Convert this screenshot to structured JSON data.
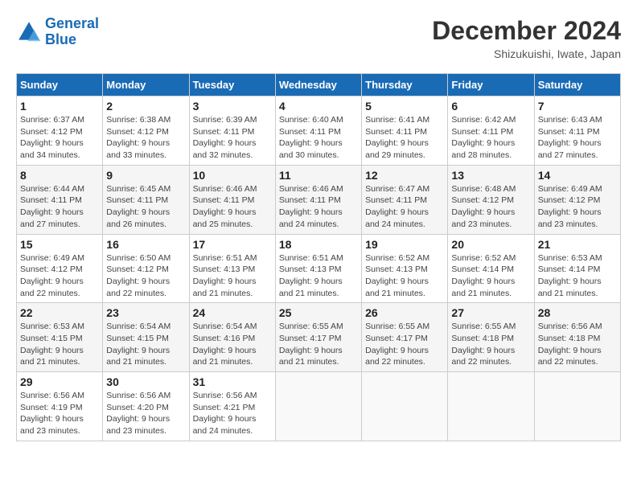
{
  "header": {
    "logo_line1": "General",
    "logo_line2": "Blue",
    "month_title": "December 2024",
    "location": "Shizukuishi, Iwate, Japan"
  },
  "weekdays": [
    "Sunday",
    "Monday",
    "Tuesday",
    "Wednesday",
    "Thursday",
    "Friday",
    "Saturday"
  ],
  "weeks": [
    [
      {
        "day": "1",
        "sunrise": "Sunrise: 6:37 AM",
        "sunset": "Sunset: 4:12 PM",
        "daylight": "Daylight: 9 hours and 34 minutes."
      },
      {
        "day": "2",
        "sunrise": "Sunrise: 6:38 AM",
        "sunset": "Sunset: 4:12 PM",
        "daylight": "Daylight: 9 hours and 33 minutes."
      },
      {
        "day": "3",
        "sunrise": "Sunrise: 6:39 AM",
        "sunset": "Sunset: 4:11 PM",
        "daylight": "Daylight: 9 hours and 32 minutes."
      },
      {
        "day": "4",
        "sunrise": "Sunrise: 6:40 AM",
        "sunset": "Sunset: 4:11 PM",
        "daylight": "Daylight: 9 hours and 30 minutes."
      },
      {
        "day": "5",
        "sunrise": "Sunrise: 6:41 AM",
        "sunset": "Sunset: 4:11 PM",
        "daylight": "Daylight: 9 hours and 29 minutes."
      },
      {
        "day": "6",
        "sunrise": "Sunrise: 6:42 AM",
        "sunset": "Sunset: 4:11 PM",
        "daylight": "Daylight: 9 hours and 28 minutes."
      },
      {
        "day": "7",
        "sunrise": "Sunrise: 6:43 AM",
        "sunset": "Sunset: 4:11 PM",
        "daylight": "Daylight: 9 hours and 27 minutes."
      }
    ],
    [
      {
        "day": "8",
        "sunrise": "Sunrise: 6:44 AM",
        "sunset": "Sunset: 4:11 PM",
        "daylight": "Daylight: 9 hours and 27 minutes."
      },
      {
        "day": "9",
        "sunrise": "Sunrise: 6:45 AM",
        "sunset": "Sunset: 4:11 PM",
        "daylight": "Daylight: 9 hours and 26 minutes."
      },
      {
        "day": "10",
        "sunrise": "Sunrise: 6:46 AM",
        "sunset": "Sunset: 4:11 PM",
        "daylight": "Daylight: 9 hours and 25 minutes."
      },
      {
        "day": "11",
        "sunrise": "Sunrise: 6:46 AM",
        "sunset": "Sunset: 4:11 PM",
        "daylight": "Daylight: 9 hours and 24 minutes."
      },
      {
        "day": "12",
        "sunrise": "Sunrise: 6:47 AM",
        "sunset": "Sunset: 4:11 PM",
        "daylight": "Daylight: 9 hours and 24 minutes."
      },
      {
        "day": "13",
        "sunrise": "Sunrise: 6:48 AM",
        "sunset": "Sunset: 4:12 PM",
        "daylight": "Daylight: 9 hours and 23 minutes."
      },
      {
        "day": "14",
        "sunrise": "Sunrise: 6:49 AM",
        "sunset": "Sunset: 4:12 PM",
        "daylight": "Daylight: 9 hours and 23 minutes."
      }
    ],
    [
      {
        "day": "15",
        "sunrise": "Sunrise: 6:49 AM",
        "sunset": "Sunset: 4:12 PM",
        "daylight": "Daylight: 9 hours and 22 minutes."
      },
      {
        "day": "16",
        "sunrise": "Sunrise: 6:50 AM",
        "sunset": "Sunset: 4:12 PM",
        "daylight": "Daylight: 9 hours and 22 minutes."
      },
      {
        "day": "17",
        "sunrise": "Sunrise: 6:51 AM",
        "sunset": "Sunset: 4:13 PM",
        "daylight": "Daylight: 9 hours and 21 minutes."
      },
      {
        "day": "18",
        "sunrise": "Sunrise: 6:51 AM",
        "sunset": "Sunset: 4:13 PM",
        "daylight": "Daylight: 9 hours and 21 minutes."
      },
      {
        "day": "19",
        "sunrise": "Sunrise: 6:52 AM",
        "sunset": "Sunset: 4:13 PM",
        "daylight": "Daylight: 9 hours and 21 minutes."
      },
      {
        "day": "20",
        "sunrise": "Sunrise: 6:52 AM",
        "sunset": "Sunset: 4:14 PM",
        "daylight": "Daylight: 9 hours and 21 minutes."
      },
      {
        "day": "21",
        "sunrise": "Sunrise: 6:53 AM",
        "sunset": "Sunset: 4:14 PM",
        "daylight": "Daylight: 9 hours and 21 minutes."
      }
    ],
    [
      {
        "day": "22",
        "sunrise": "Sunrise: 6:53 AM",
        "sunset": "Sunset: 4:15 PM",
        "daylight": "Daylight: 9 hours and 21 minutes."
      },
      {
        "day": "23",
        "sunrise": "Sunrise: 6:54 AM",
        "sunset": "Sunset: 4:15 PM",
        "daylight": "Daylight: 9 hours and 21 minutes."
      },
      {
        "day": "24",
        "sunrise": "Sunrise: 6:54 AM",
        "sunset": "Sunset: 4:16 PM",
        "daylight": "Daylight: 9 hours and 21 minutes."
      },
      {
        "day": "25",
        "sunrise": "Sunrise: 6:55 AM",
        "sunset": "Sunset: 4:17 PM",
        "daylight": "Daylight: 9 hours and 21 minutes."
      },
      {
        "day": "26",
        "sunrise": "Sunrise: 6:55 AM",
        "sunset": "Sunset: 4:17 PM",
        "daylight": "Daylight: 9 hours and 22 minutes."
      },
      {
        "day": "27",
        "sunrise": "Sunrise: 6:55 AM",
        "sunset": "Sunset: 4:18 PM",
        "daylight": "Daylight: 9 hours and 22 minutes."
      },
      {
        "day": "28",
        "sunrise": "Sunrise: 6:56 AM",
        "sunset": "Sunset: 4:18 PM",
        "daylight": "Daylight: 9 hours and 22 minutes."
      }
    ],
    [
      {
        "day": "29",
        "sunrise": "Sunrise: 6:56 AM",
        "sunset": "Sunset: 4:19 PM",
        "daylight": "Daylight: 9 hours and 23 minutes."
      },
      {
        "day": "30",
        "sunrise": "Sunrise: 6:56 AM",
        "sunset": "Sunset: 4:20 PM",
        "daylight": "Daylight: 9 hours and 23 minutes."
      },
      {
        "day": "31",
        "sunrise": "Sunrise: 6:56 AM",
        "sunset": "Sunset: 4:21 PM",
        "daylight": "Daylight: 9 hours and 24 minutes."
      },
      null,
      null,
      null,
      null
    ]
  ]
}
